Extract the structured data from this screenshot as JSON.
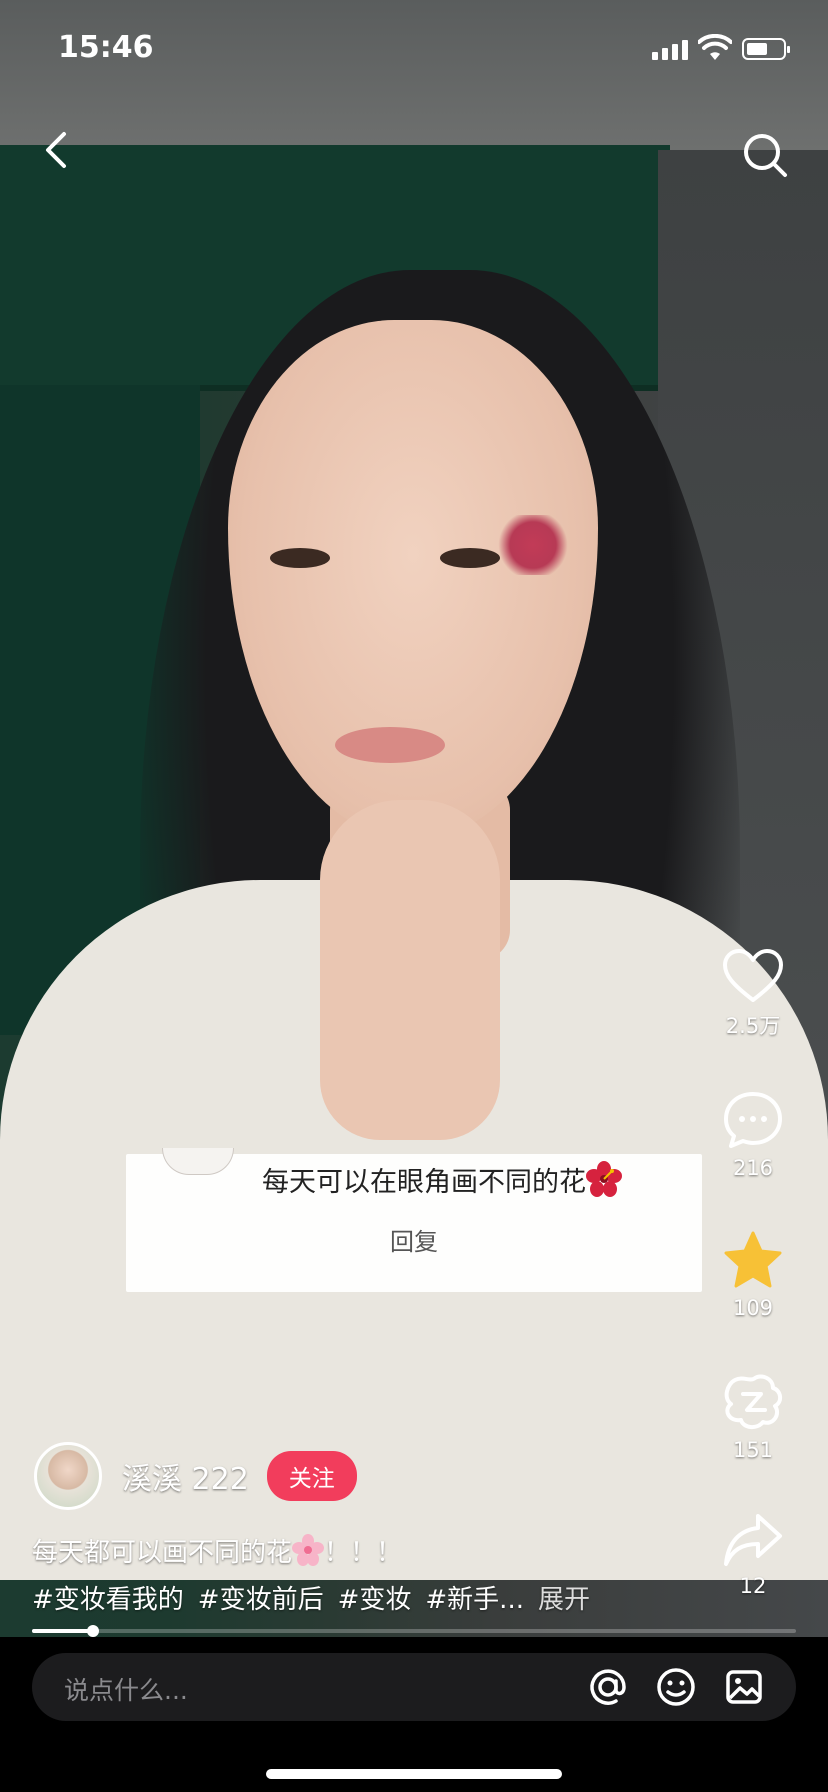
{
  "status_bar": {
    "time": "15:46"
  },
  "post": {
    "author": {
      "name": "溪溪 222",
      "follow_label": "关注"
    },
    "description": "每天都可以画不同的花",
    "description_suffix": "！！！",
    "hashtags": [
      "#变妆看我的",
      "#变妆前后",
      "#变妆",
      "#新手..."
    ],
    "expand_label": "展开",
    "progress": 0.08
  },
  "pinned_comment": {
    "text": "每天可以在眼角画不同的花",
    "reply_label": "回复"
  },
  "actions": {
    "like": {
      "icon": "heart-icon",
      "count": "2.5万"
    },
    "comment": {
      "icon": "comment-icon",
      "count": "216"
    },
    "favorite": {
      "icon": "star-icon",
      "count": "109",
      "color": "#F7C136"
    },
    "mix": {
      "icon": "remix-icon",
      "count": "151"
    },
    "share": {
      "icon": "share-arrow-icon",
      "count": "12"
    }
  },
  "comment_input": {
    "placeholder": "说点什么..."
  },
  "colors": {
    "follow": "#F23D5C",
    "favorite": "#F7C136"
  }
}
